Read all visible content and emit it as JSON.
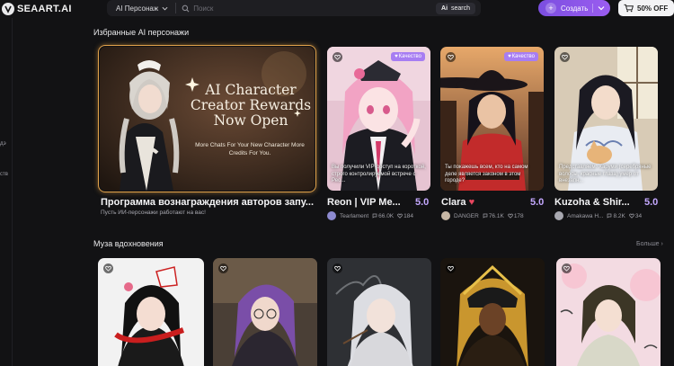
{
  "header": {
    "logo_text": "SEAART.AI",
    "search_category": "AI Персонаж",
    "search_placeholder": "Поиск",
    "ai_search_label": "search",
    "create_label": "Создать",
    "offer_label": "50% OFF"
  },
  "sidebar": {
    "mark1": "дэ",
    "mark2": "ств"
  },
  "featured_section": {
    "title": "Избранные AI персонажи",
    "banner": {
      "headline": "AI Character Creator Rewards Now Open",
      "subline": "More Chats For Your New Character More Credits For You.",
      "name": "Программа вознаграждения авторов запу...",
      "subtitle": "Пусть ИИ-персонажи работают на вас!"
    },
    "quality_label": "Качество",
    "cards": [
      {
        "name": "Reon | VIP Me...",
        "score": "5.0",
        "author": "Tearlament",
        "chats": "66.0K",
        "likes": "184",
        "desc": "Вы получили VIP-доступ на короткой, строго контролируемой встрече с Рео...",
        "quality": true
      },
      {
        "name": "Clara",
        "score": "5.0",
        "author": "DANGER",
        "chats": "76.1K",
        "likes": "178",
        "desc": "Ты покажешь всем, кто на самом деле является законом в этом городе?",
        "quality": true
      },
      {
        "name": "Kuzoha & Shir...",
        "score": "5.0",
        "author": "Amakawa H...",
        "chats": "8.2K",
        "likes": "34",
        "desc": "Представляем: Харуми (серебряные волосы, красные глаза) умер от внезапн...",
        "quality": false
      }
    ]
  },
  "muse_section": {
    "title": "Муза вдохновения",
    "more_label": "Больше"
  }
}
